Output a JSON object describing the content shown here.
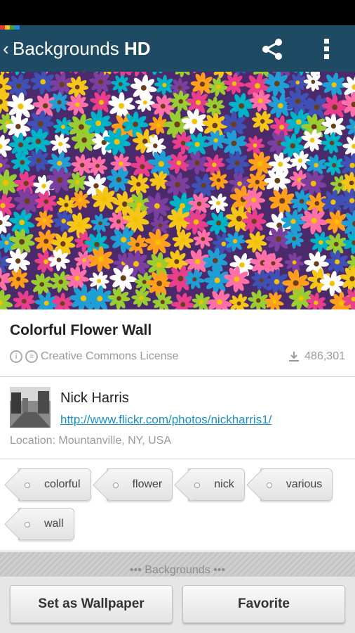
{
  "appbar": {
    "title_regular": "Backgrounds ",
    "title_bold": "HD",
    "back_glyph": "‹",
    "share_icon": "share-icon",
    "menu_icon": "overflow-menu-icon",
    "bar_color": "#1e4a63"
  },
  "stripe_colors": [
    "#e53935",
    "#fbc02d",
    "#43a047",
    "#1e88e5"
  ],
  "wallpaper": {
    "title": "Colorful Flower Wall",
    "license": "Creative Commons License",
    "downloads": "486,301"
  },
  "author": {
    "name": "Nick Harris",
    "url": "http://www.flickr.com/photos/nickharris1/",
    "location": "Location: Mountanville, NY, USA"
  },
  "tags": [
    "colorful",
    "flower",
    "nick",
    "various",
    "wall"
  ],
  "section_strip": "••• Backgrounds •••",
  "actions": {
    "set_wallpaper": "Set as Wallpaper",
    "favorite": "Favorite"
  }
}
